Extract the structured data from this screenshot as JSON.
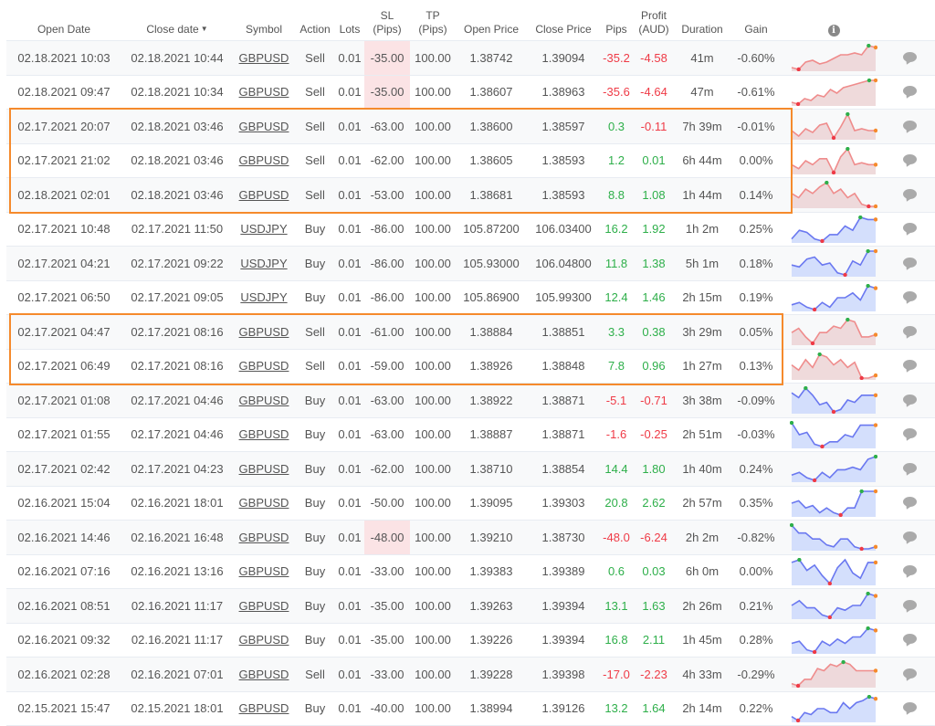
{
  "table": {
    "headers": {
      "open_date": "Open Date",
      "close_date": "Close date",
      "sort_indicator": "▼",
      "symbol": "Symbol",
      "action": "Action",
      "lots": "Lots",
      "sl_line1": "SL",
      "sl_line2": "(Pips)",
      "tp_line1": "TP",
      "tp_line2": "(Pips)",
      "open_price": "Open Price",
      "close_price": "Close Price",
      "pips": "Pips",
      "profit_line1": "Profit",
      "profit_line2": "(AUD)",
      "duration": "Duration",
      "gain": "Gain",
      "info_icon": "i"
    },
    "colors": {
      "positive": "#2eaf4a",
      "negative": "#ef3a46",
      "highlight_box": "#f58a2c",
      "sl_hit_bg": "#fbe3e5",
      "spark_sell_line": "#ef8c8c",
      "spark_sell_fill": "#ecd3d5",
      "spark_buy_line": "#6a78f0",
      "spark_buy_fill": "#cdd9fb",
      "spark_max": "#2eaf4a",
      "spark_min": "#ef3a46",
      "spark_last": "#f58a2c"
    },
    "rows": [
      {
        "open_date": "02.18.2021 10:03",
        "close_date": "02.18.2021 10:44",
        "symbol": "GBPUSD",
        "action": "Sell",
        "lots": "0.01",
        "sl": "-35.00",
        "sl_hit": true,
        "tp": "100.00",
        "open_price": "1.38742",
        "close_price": "1.39094",
        "pips": "-35.2",
        "profit": "-4.58",
        "duration": "41m",
        "gain": "-0.60%",
        "spark": [
          1,
          0,
          4,
          5,
          3,
          4,
          6,
          8,
          8,
          9,
          8,
          13,
          12
        ]
      },
      {
        "open_date": "02.18.2021 09:47",
        "close_date": "02.18.2021 10:34",
        "symbol": "GBPUSD",
        "action": "Sell",
        "lots": "0.01",
        "sl": "-35.00",
        "sl_hit": true,
        "tp": "100.00",
        "open_price": "1.38607",
        "close_price": "1.38963",
        "pips": "-35.6",
        "profit": "-4.64",
        "duration": "47m",
        "gain": "-0.61%",
        "spark": [
          1,
          0,
          3,
          2,
          5,
          4,
          8,
          6,
          9,
          10,
          11,
          12,
          13,
          13
        ]
      },
      {
        "open_date": "02.17.2021 20:07",
        "close_date": "02.18.2021 03:46",
        "symbol": "GBPUSD",
        "action": "Sell",
        "lots": "0.01",
        "sl": "-63.00",
        "sl_hit": false,
        "tp": "100.00",
        "open_price": "1.38600",
        "close_price": "1.38597",
        "pips": "0.3",
        "profit": "-0.11",
        "duration": "7h 39m",
        "gain": "-0.01%",
        "spark": [
          4,
          1,
          5,
          3,
          7,
          8,
          0,
          6,
          13,
          4,
          5,
          4,
          4
        ]
      },
      {
        "open_date": "02.17.2021 21:02",
        "close_date": "02.18.2021 03:46",
        "symbol": "GBPUSD",
        "action": "Sell",
        "lots": "0.01",
        "sl": "-62.00",
        "sl_hit": false,
        "tp": "100.00",
        "open_price": "1.38605",
        "close_price": "1.38593",
        "pips": "1.2",
        "profit": "0.01",
        "duration": "6h 44m",
        "gain": "0.00%",
        "spark": [
          4,
          2,
          6,
          4,
          7,
          7,
          0,
          8,
          12,
          4,
          5,
          4,
          4
        ]
      },
      {
        "open_date": "02.18.2021 02:01",
        "close_date": "02.18.2021 03:46",
        "symbol": "GBPUSD",
        "action": "Sell",
        "lots": "0.01",
        "sl": "-53.00",
        "sl_hit": false,
        "tp": "100.00",
        "open_price": "1.38681",
        "close_price": "1.38593",
        "pips": "8.8",
        "profit": "1.08",
        "duration": "1h 44m",
        "gain": "0.14%",
        "spark": [
          6,
          4,
          8,
          6,
          9,
          11,
          6,
          8,
          4,
          6,
          1,
          0,
          0
        ]
      },
      {
        "open_date": "02.17.2021 10:48",
        "close_date": "02.17.2021 11:50",
        "symbol": "USDJPY",
        "action": "Buy",
        "lots": "0.01",
        "sl": "-86.00",
        "sl_hit": false,
        "tp": "100.00",
        "open_price": "105.87200",
        "close_price": "106.03400",
        "pips": "16.2",
        "profit": "1.92",
        "duration": "1h 2m",
        "gain": "0.25%",
        "spark": [
          1,
          5,
          4,
          1,
          0,
          3,
          3,
          7,
          5,
          11,
          10,
          10
        ]
      },
      {
        "open_date": "02.17.2021 04:21",
        "close_date": "02.17.2021 09:22",
        "symbol": "USDJPY",
        "action": "Buy",
        "lots": "0.01",
        "sl": "-86.00",
        "sl_hit": false,
        "tp": "100.00",
        "open_price": "105.93000",
        "close_price": "106.04800",
        "pips": "11.8",
        "profit": "1.38",
        "duration": "5h 1m",
        "gain": "0.18%",
        "spark": [
          5,
          4,
          8,
          9,
          5,
          6,
          1,
          0,
          7,
          5,
          12,
          12
        ]
      },
      {
        "open_date": "02.17.2021 06:50",
        "close_date": "02.17.2021 09:05",
        "symbol": "USDJPY",
        "action": "Buy",
        "lots": "0.01",
        "sl": "-86.00",
        "sl_hit": false,
        "tp": "100.00",
        "open_price": "105.86900",
        "close_price": "105.99300",
        "pips": "12.4",
        "profit": "1.46",
        "duration": "2h 15m",
        "gain": "0.19%",
        "spark": [
          2,
          3,
          1,
          0,
          3,
          1,
          5,
          5,
          7,
          4,
          10,
          9
        ]
      },
      {
        "open_date": "02.17.2021 04:47",
        "close_date": "02.17.2021 08:16",
        "symbol": "GBPUSD",
        "action": "Sell",
        "lots": "0.01",
        "sl": "-61.00",
        "sl_hit": false,
        "tp": "100.00",
        "open_price": "1.38884",
        "close_price": "1.38851",
        "pips": "3.3",
        "profit": "0.38",
        "duration": "3h 29m",
        "gain": "0.05%",
        "spark": [
          5,
          7,
          3,
          0,
          5,
          5,
          8,
          7,
          11,
          10,
          3,
          3,
          4
        ]
      },
      {
        "open_date": "02.17.2021 06:49",
        "close_date": "02.17.2021 08:16",
        "symbol": "GBPUSD",
        "action": "Sell",
        "lots": "0.01",
        "sl": "-59.00",
        "sl_hit": false,
        "tp": "100.00",
        "open_price": "1.38926",
        "close_price": "1.38848",
        "pips": "7.8",
        "profit": "0.96",
        "duration": "1h 27m",
        "gain": "0.13%",
        "spark": [
          5,
          3,
          7,
          4,
          9,
          8,
          5,
          7,
          4,
          6,
          0,
          0,
          1
        ]
      },
      {
        "open_date": "02.17.2021 01:08",
        "close_date": "02.17.2021 04:46",
        "symbol": "GBPUSD",
        "action": "Buy",
        "lots": "0.01",
        "sl": "-63.00",
        "sl_hit": false,
        "tp": "100.00",
        "open_price": "1.38922",
        "close_price": "1.38871",
        "pips": "-5.1",
        "profit": "-0.71",
        "duration": "3h 38m",
        "gain": "-0.09%",
        "spark": [
          8,
          6,
          10,
          7,
          3,
          4,
          0,
          1,
          5,
          4,
          7,
          7,
          7
        ]
      },
      {
        "open_date": "02.17.2021 01:55",
        "close_date": "02.17.2021 04:46",
        "symbol": "GBPUSD",
        "action": "Buy",
        "lots": "0.01",
        "sl": "-63.00",
        "sl_hit": false,
        "tp": "100.00",
        "open_price": "1.38887",
        "close_price": "1.38871",
        "pips": "-1.6",
        "profit": "-0.25",
        "duration": "2h 51m",
        "gain": "-0.03%",
        "spark": [
          10,
          5,
          6,
          1,
          0,
          2,
          2,
          5,
          4,
          9,
          9,
          9
        ]
      },
      {
        "open_date": "02.17.2021 02:42",
        "close_date": "02.17.2021 04:23",
        "symbol": "GBPUSD",
        "action": "Buy",
        "lots": "0.01",
        "sl": "-62.00",
        "sl_hit": false,
        "tp": "100.00",
        "open_price": "1.38710",
        "close_price": "1.38854",
        "pips": "14.4",
        "profit": "1.80",
        "duration": "1h 40m",
        "gain": "0.24%",
        "spark": [
          2,
          3,
          1,
          0,
          3,
          1,
          4,
          4,
          5,
          4,
          8,
          9
        ]
      },
      {
        "open_date": "02.16.2021 15:04",
        "close_date": "02.16.2021 18:01",
        "symbol": "GBPUSD",
        "action": "Buy",
        "lots": "0.01",
        "sl": "-50.00",
        "sl_hit": false,
        "tp": "100.00",
        "open_price": "1.39095",
        "close_price": "1.39303",
        "pips": "20.8",
        "profit": "2.62",
        "duration": "2h 57m",
        "gain": "0.35%",
        "spark": [
          5,
          6,
          3,
          4,
          1,
          3,
          1,
          0,
          3,
          3,
          10,
          10,
          10
        ]
      },
      {
        "open_date": "02.16.2021 14:46",
        "close_date": "02.16.2021 16:48",
        "symbol": "GBPUSD",
        "action": "Buy",
        "lots": "0.01",
        "sl": "-48.00",
        "sl_hit": true,
        "tp": "100.00",
        "open_price": "1.39210",
        "close_price": "1.38730",
        "pips": "-48.0",
        "profit": "-6.24",
        "duration": "2h 2m",
        "gain": "-0.82%",
        "spark": [
          12,
          8,
          8,
          5,
          5,
          2,
          1,
          5,
          5,
          1,
          0,
          0,
          1
        ]
      },
      {
        "open_date": "02.16.2021 07:16",
        "close_date": "02.16.2021 13:16",
        "symbol": "GBPUSD",
        "action": "Buy",
        "lots": "0.01",
        "sl": "-33.00",
        "sl_hit": false,
        "tp": "100.00",
        "open_price": "1.39383",
        "close_price": "1.39389",
        "pips": "0.6",
        "profit": "0.03",
        "duration": "6h 0m",
        "gain": "0.00%",
        "spark": [
          8,
          9,
          5,
          7,
          3,
          0,
          6,
          9,
          4,
          2,
          8,
          8
        ]
      },
      {
        "open_date": "02.16.2021 08:51",
        "close_date": "02.16.2021 11:17",
        "symbol": "GBPUSD",
        "action": "Buy",
        "lots": "0.01",
        "sl": "-35.00",
        "sl_hit": false,
        "tp": "100.00",
        "open_price": "1.39263",
        "close_price": "1.39394",
        "pips": "13.1",
        "profit": "1.63",
        "duration": "2h 26m",
        "gain": "0.21%",
        "spark": [
          5,
          7,
          4,
          4,
          1,
          0,
          4,
          3,
          5,
          5,
          10,
          9
        ]
      },
      {
        "open_date": "02.16.2021 09:32",
        "close_date": "02.16.2021 11:17",
        "symbol": "GBPUSD",
        "action": "Buy",
        "lots": "0.01",
        "sl": "-35.00",
        "sl_hit": false,
        "tp": "100.00",
        "open_price": "1.39226",
        "close_price": "1.39394",
        "pips": "16.8",
        "profit": "2.11",
        "duration": "1h 45m",
        "gain": "0.28%",
        "spark": [
          4,
          5,
          1,
          0,
          5,
          3,
          6,
          4,
          7,
          7,
          11,
          10
        ]
      },
      {
        "open_date": "02.16.2021 02:28",
        "close_date": "02.16.2021 07:01",
        "symbol": "GBPUSD",
        "action": "Sell",
        "lots": "0.01",
        "sl": "-33.00",
        "sl_hit": false,
        "tp": "100.00",
        "open_price": "1.39228",
        "close_price": "1.39398",
        "pips": "-17.0",
        "profit": "-2.23",
        "duration": "4h 33m",
        "gain": "-0.29%",
        "spark": [
          1,
          0,
          3,
          3,
          8,
          7,
          10,
          9,
          11,
          10,
          7,
          7,
          7,
          7
        ]
      },
      {
        "open_date": "02.15.2021 15:47",
        "close_date": "02.15.2021 18:01",
        "symbol": "GBPUSD",
        "action": "Buy",
        "lots": "0.01",
        "sl": "-40.00",
        "sl_hit": false,
        "tp": "100.00",
        "open_price": "1.38994",
        "close_price": "1.39126",
        "pips": "13.2",
        "profit": "1.64",
        "duration": "2h 14m",
        "gain": "0.22%",
        "spark": [
          2,
          0,
          4,
          3,
          6,
          6,
          4,
          4,
          9,
          6,
          9,
          10,
          12,
          11
        ]
      }
    ],
    "highlight_groups": [
      [
        2,
        4
      ],
      [
        8,
        9
      ]
    ]
  }
}
